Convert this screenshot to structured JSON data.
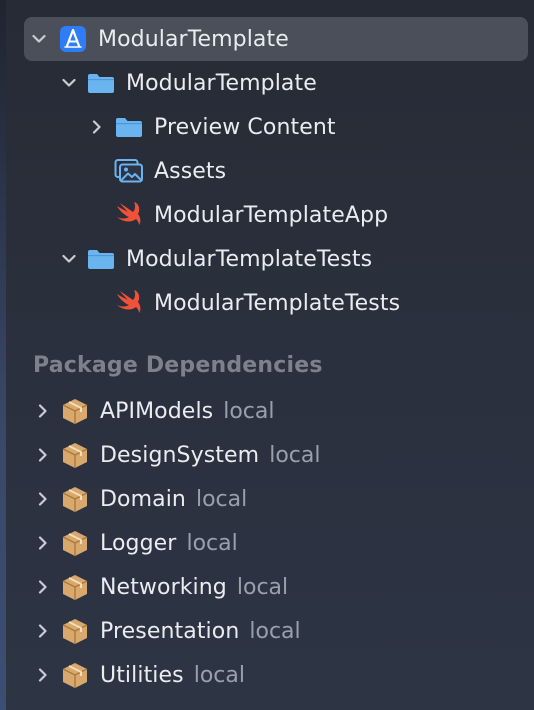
{
  "project": {
    "name": "ModularTemplate",
    "groups": [
      {
        "name": "ModularTemplate",
        "children": [
          {
            "name": "Preview Content",
            "kind": "folder"
          },
          {
            "name": "Assets",
            "kind": "assets"
          },
          {
            "name": "ModularTemplateApp",
            "kind": "swift"
          }
        ]
      },
      {
        "name": "ModularTemplateTests",
        "children": [
          {
            "name": "ModularTemplateTests",
            "kind": "swift"
          }
        ]
      }
    ]
  },
  "packages": {
    "header": "Package Dependencies",
    "items": [
      {
        "name": "APIModels",
        "tag": "local"
      },
      {
        "name": "DesignSystem",
        "tag": "local"
      },
      {
        "name": "Domain",
        "tag": "local"
      },
      {
        "name": "Logger",
        "tag": "local"
      },
      {
        "name": "Networking",
        "tag": "local"
      },
      {
        "name": "Presentation",
        "tag": "local"
      },
      {
        "name": "Utilities",
        "tag": "local"
      }
    ]
  },
  "colors": {
    "folder": "#6ab4f0",
    "swift": "#f05138",
    "package": "#d9a86c",
    "app_icon": "#2f7df6"
  }
}
